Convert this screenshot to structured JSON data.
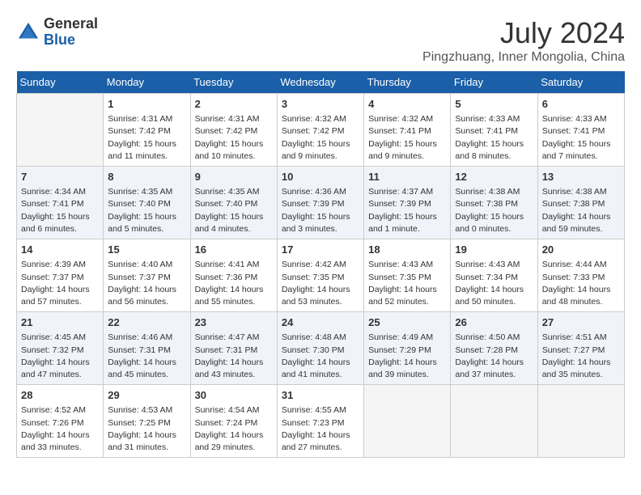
{
  "logo": {
    "general": "General",
    "blue": "Blue"
  },
  "title": "July 2024",
  "location": "Pingzhuang, Inner Mongolia, China",
  "days_of_week": [
    "Sunday",
    "Monday",
    "Tuesday",
    "Wednesday",
    "Thursday",
    "Friday",
    "Saturday"
  ],
  "weeks": [
    [
      {
        "day": "",
        "content": ""
      },
      {
        "day": "1",
        "content": "Sunrise: 4:31 AM\nSunset: 7:42 PM\nDaylight: 15 hours\nand 11 minutes."
      },
      {
        "day": "2",
        "content": "Sunrise: 4:31 AM\nSunset: 7:42 PM\nDaylight: 15 hours\nand 10 minutes."
      },
      {
        "day": "3",
        "content": "Sunrise: 4:32 AM\nSunset: 7:42 PM\nDaylight: 15 hours\nand 9 minutes."
      },
      {
        "day": "4",
        "content": "Sunrise: 4:32 AM\nSunset: 7:41 PM\nDaylight: 15 hours\nand 9 minutes."
      },
      {
        "day": "5",
        "content": "Sunrise: 4:33 AM\nSunset: 7:41 PM\nDaylight: 15 hours\nand 8 minutes."
      },
      {
        "day": "6",
        "content": "Sunrise: 4:33 AM\nSunset: 7:41 PM\nDaylight: 15 hours\nand 7 minutes."
      }
    ],
    [
      {
        "day": "7",
        "content": "Sunrise: 4:34 AM\nSunset: 7:41 PM\nDaylight: 15 hours\nand 6 minutes."
      },
      {
        "day": "8",
        "content": "Sunrise: 4:35 AM\nSunset: 7:40 PM\nDaylight: 15 hours\nand 5 minutes."
      },
      {
        "day": "9",
        "content": "Sunrise: 4:35 AM\nSunset: 7:40 PM\nDaylight: 15 hours\nand 4 minutes."
      },
      {
        "day": "10",
        "content": "Sunrise: 4:36 AM\nSunset: 7:39 PM\nDaylight: 15 hours\nand 3 minutes."
      },
      {
        "day": "11",
        "content": "Sunrise: 4:37 AM\nSunset: 7:39 PM\nDaylight: 15 hours\nand 1 minute."
      },
      {
        "day": "12",
        "content": "Sunrise: 4:38 AM\nSunset: 7:38 PM\nDaylight: 15 hours\nand 0 minutes."
      },
      {
        "day": "13",
        "content": "Sunrise: 4:38 AM\nSunset: 7:38 PM\nDaylight: 14 hours\nand 59 minutes."
      }
    ],
    [
      {
        "day": "14",
        "content": "Sunrise: 4:39 AM\nSunset: 7:37 PM\nDaylight: 14 hours\nand 57 minutes."
      },
      {
        "day": "15",
        "content": "Sunrise: 4:40 AM\nSunset: 7:37 PM\nDaylight: 14 hours\nand 56 minutes."
      },
      {
        "day": "16",
        "content": "Sunrise: 4:41 AM\nSunset: 7:36 PM\nDaylight: 14 hours\nand 55 minutes."
      },
      {
        "day": "17",
        "content": "Sunrise: 4:42 AM\nSunset: 7:35 PM\nDaylight: 14 hours\nand 53 minutes."
      },
      {
        "day": "18",
        "content": "Sunrise: 4:43 AM\nSunset: 7:35 PM\nDaylight: 14 hours\nand 52 minutes."
      },
      {
        "day": "19",
        "content": "Sunrise: 4:43 AM\nSunset: 7:34 PM\nDaylight: 14 hours\nand 50 minutes."
      },
      {
        "day": "20",
        "content": "Sunrise: 4:44 AM\nSunset: 7:33 PM\nDaylight: 14 hours\nand 48 minutes."
      }
    ],
    [
      {
        "day": "21",
        "content": "Sunrise: 4:45 AM\nSunset: 7:32 PM\nDaylight: 14 hours\nand 47 minutes."
      },
      {
        "day": "22",
        "content": "Sunrise: 4:46 AM\nSunset: 7:31 PM\nDaylight: 14 hours\nand 45 minutes."
      },
      {
        "day": "23",
        "content": "Sunrise: 4:47 AM\nSunset: 7:31 PM\nDaylight: 14 hours\nand 43 minutes."
      },
      {
        "day": "24",
        "content": "Sunrise: 4:48 AM\nSunset: 7:30 PM\nDaylight: 14 hours\nand 41 minutes."
      },
      {
        "day": "25",
        "content": "Sunrise: 4:49 AM\nSunset: 7:29 PM\nDaylight: 14 hours\nand 39 minutes."
      },
      {
        "day": "26",
        "content": "Sunrise: 4:50 AM\nSunset: 7:28 PM\nDaylight: 14 hours\nand 37 minutes."
      },
      {
        "day": "27",
        "content": "Sunrise: 4:51 AM\nSunset: 7:27 PM\nDaylight: 14 hours\nand 35 minutes."
      }
    ],
    [
      {
        "day": "28",
        "content": "Sunrise: 4:52 AM\nSunset: 7:26 PM\nDaylight: 14 hours\nand 33 minutes."
      },
      {
        "day": "29",
        "content": "Sunrise: 4:53 AM\nSunset: 7:25 PM\nDaylight: 14 hours\nand 31 minutes."
      },
      {
        "day": "30",
        "content": "Sunrise: 4:54 AM\nSunset: 7:24 PM\nDaylight: 14 hours\nand 29 minutes."
      },
      {
        "day": "31",
        "content": "Sunrise: 4:55 AM\nSunset: 7:23 PM\nDaylight: 14 hours\nand 27 minutes."
      },
      {
        "day": "",
        "content": ""
      },
      {
        "day": "",
        "content": ""
      },
      {
        "day": "",
        "content": ""
      }
    ]
  ]
}
